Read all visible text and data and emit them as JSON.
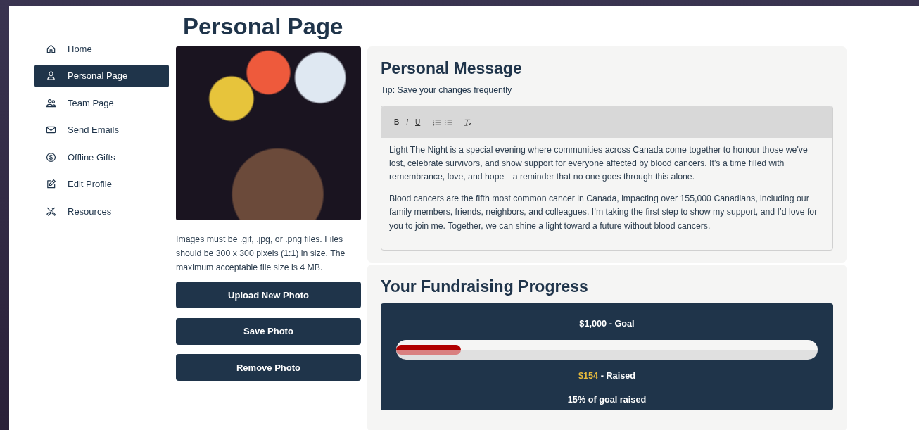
{
  "sidebar": {
    "items": [
      {
        "label": "Home",
        "kind": "home",
        "selected": false
      },
      {
        "label": "Personal Page",
        "kind": "person",
        "selected": true
      },
      {
        "label": "Team Page",
        "kind": "people",
        "selected": false
      },
      {
        "label": "Send Emails",
        "kind": "mail",
        "selected": false
      },
      {
        "label": "Offline Gifts",
        "kind": "dollar",
        "selected": false
      },
      {
        "label": "Edit Profile",
        "kind": "edit",
        "selected": false
      },
      {
        "label": "Resources",
        "kind": "tools",
        "selected": false
      }
    ]
  },
  "page_title": "Personal Page",
  "photo": {
    "note": "Images must be .gif, .jpg, or .png files. Files should be 300 x 300 pixels (1:1) in size. The maximum acceptable file size is 4 MB.",
    "buttons": [
      "Upload New Photo",
      "Save Photo",
      "Remove Photo"
    ]
  },
  "message": {
    "title": "Personal Message",
    "tip": "Tip: Save your changes frequently",
    "toolbar": [
      {
        "kind": "bold",
        "label": "B"
      },
      {
        "kind": "italic",
        "label": "I"
      },
      {
        "kind": "underline",
        "label": "U"
      },
      {
        "kind": "ordered-list"
      },
      {
        "kind": "bullet-list"
      },
      {
        "kind": "clear-format"
      }
    ],
    "paragraphs": [
      "Light The Night is a special evening where communities across Canada come together to honour those we've lost, celebrate survivors, and show support for everyone affected by blood cancers. It’s a time filled with remembrance, love, and hope—a reminder that no one goes through this alone.",
      "Blood cancers are the fifth most common cancer in Canada, impacting over 155,000 Canadians, including our family members, friends, neighbors, and colleagues. I’m taking the first step to show my support, and I’d love for you to join me. Together, we can shine a light toward a future without blood cancers."
    ]
  },
  "progress": {
    "title": "Your Fundraising Progress",
    "goal_amount": "$1,000",
    "goal_label": "- Goal",
    "level": 0.154,
    "raised_amount": "$154",
    "raised_label": "- Raised",
    "percent_text": "15% of goal raised"
  }
}
